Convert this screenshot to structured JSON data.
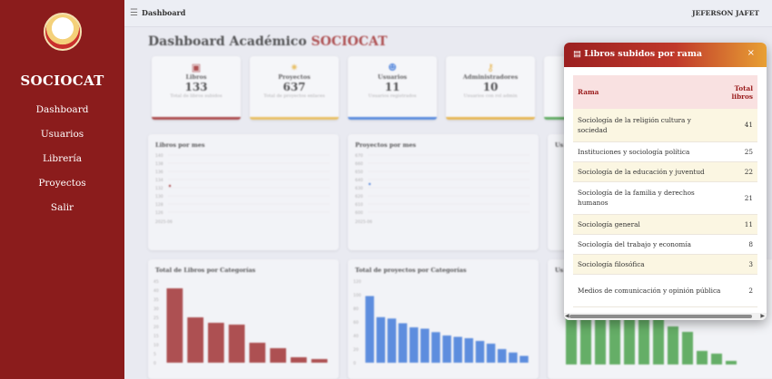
{
  "sidebar": {
    "brand": "SOCIOCAT",
    "items": [
      {
        "label": "Dashboard"
      },
      {
        "label": "Usuarios"
      },
      {
        "label": "Librería"
      },
      {
        "label": "Proyectos"
      },
      {
        "label": "Salir"
      }
    ]
  },
  "topbar": {
    "breadcrumb": "Dashboard",
    "user": "JEFERSON JAFET"
  },
  "header": {
    "title_main": "Dashboard Académico",
    "title_accent": "SOCIOCAT"
  },
  "stats": [
    {
      "label": "Libros",
      "value": "133",
      "sub": "Total de libros subidos",
      "color": "#9a1d1d",
      "icon": "book-icon",
      "glyph": "▣"
    },
    {
      "label": "Proyectos",
      "value": "637",
      "sub": "Total de proyectos enlaces",
      "color": "#e8b33a",
      "icon": "lightbulb-icon",
      "glyph": "✷"
    },
    {
      "label": "Usuarios",
      "value": "11",
      "sub": "Usuarios registrados",
      "color": "#2f6fd8",
      "icon": "users-icon",
      "glyph": "☻"
    },
    {
      "label": "Administradores",
      "value": "10",
      "sub": "Usuarios con rol admin",
      "color": "#e6a825",
      "icon": "admin-icon",
      "glyph": "⚷"
    }
  ],
  "charts": {
    "libros_mes": {
      "title": "Libros por mes",
      "yticks": [
        "140",
        "138",
        "136",
        "134",
        "132",
        "130",
        "128",
        "126"
      ],
      "xtick": "2025-06"
    },
    "proyectos_mes": {
      "title": "Proyectos por mes",
      "yticks": [
        "670",
        "660",
        "650",
        "640",
        "630",
        "620",
        "610",
        "600"
      ],
      "xtick": "2025-06"
    },
    "libros_cat": {
      "title": "Total de Libros por Categorías",
      "yticks": [
        "45",
        "40",
        "35",
        "30",
        "25",
        "20",
        "15",
        "10",
        "5",
        "0"
      ]
    },
    "proyectos_cat": {
      "title": "Total de proyectos por Categorías",
      "yticks": [
        "120",
        "100",
        "80",
        "60",
        "40",
        "20",
        "0"
      ]
    },
    "third_mes_title": "Us",
    "third_cat_title": "Us"
  },
  "chart_data": [
    {
      "type": "bar",
      "title": "Total de Libros por Categorías",
      "values": [
        41,
        25,
        22,
        21,
        11,
        8,
        3,
        2
      ],
      "ylim": [
        0,
        45
      ],
      "color": "#9a1d1d"
    },
    {
      "type": "bar",
      "title": "Total de proyectos por Categorías",
      "values": [
        98,
        67,
        65,
        58,
        52,
        50,
        45,
        40,
        38,
        36,
        32,
        28,
        20,
        15,
        10
      ],
      "ylim": [
        0,
        120
      ],
      "color": "#2f6fd8"
    }
  ],
  "modal": {
    "title": "Libros subidos por rama",
    "icon": "book-icon",
    "close": "×",
    "headers": {
      "rama": "Rama",
      "total_1": "Total",
      "total_2": "libros"
    },
    "rows": [
      {
        "rama": "Sociología de la religión cultura y sociedad",
        "total": "41"
      },
      {
        "rama": "Instituciones y sociología política",
        "total": "25"
      },
      {
        "rama": "Sociología de la educación y juventud",
        "total": "22"
      },
      {
        "rama": "Sociología de la familia y derechos humanos",
        "total": "21"
      },
      {
        "rama": "Sociología general",
        "total": "11"
      },
      {
        "rama": "Sociología del trabajo y economía",
        "total": "8"
      },
      {
        "rama": "Sociología filosófica",
        "total": "3"
      },
      {
        "rama": "Medios de comunicación y opinión pública",
        "total": "2"
      }
    ]
  }
}
